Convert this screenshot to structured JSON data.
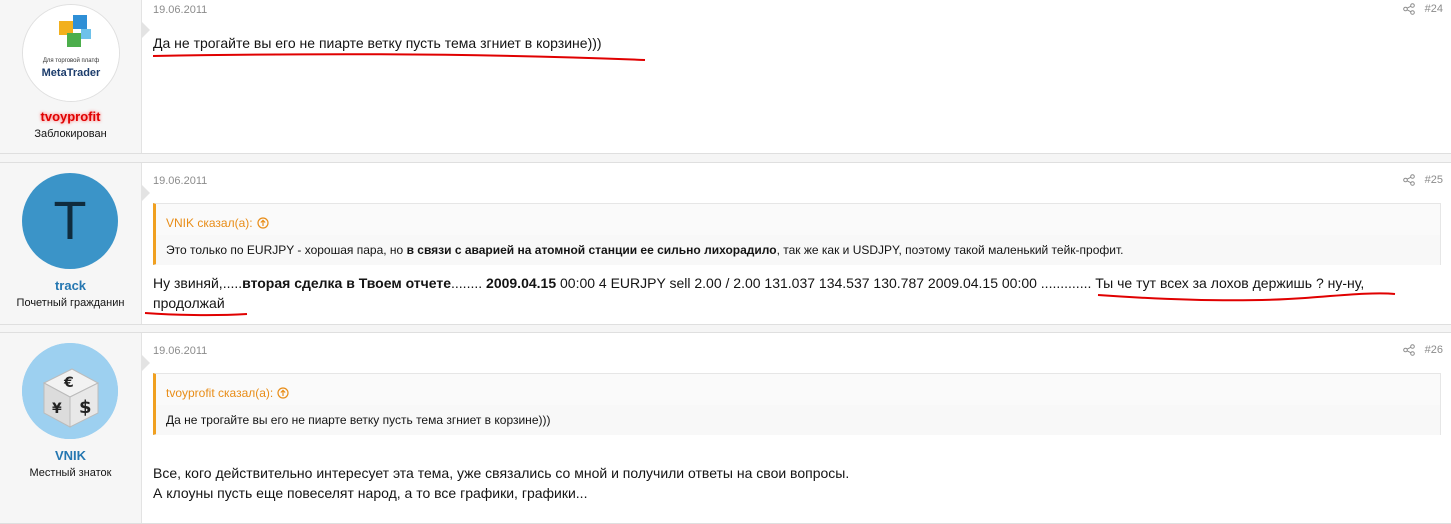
{
  "posts": [
    {
      "date": "19.06.2011",
      "number": "#24",
      "user": {
        "name": "tvoyprofit",
        "title": "Заблокирован",
        "avatar_text_small": "Для торговой платф",
        "avatar_text_main": "MetaTrader"
      },
      "message": "Да не трогайте вы его не пиарте ветку пусть тема згниет в корзине)))"
    },
    {
      "date": "19.06.2011",
      "number": "#25",
      "user": {
        "name": "track",
        "title": "Почетный гражданин",
        "avatar_letter": "T"
      },
      "quote": {
        "author": "VNIK сказал(а):",
        "text_1": "Это только по EURJPY - хорошая пара, но ",
        "text_bold": "в связи с аварией на атомной станции ее сильно лихорадило",
        "text_2": ", так же как и USDJPY, поэтому такой маленький тейк-профит."
      },
      "message": {
        "part1": "Ну звиняй,.....",
        "bold1": "вторая сделка в Твоем отчете",
        "part2": "........ ",
        "bold2": "2009.04.15",
        "part3": " 00:00 4 EURJPY sell 2.00 / 2.00 131.037 134.537 130.787 2009.04.15 00:00 ............. Ты че тут всех за лохов держишь ? ну-ну,",
        "line2": "продолжай"
      }
    },
    {
      "date": "19.06.2011",
      "number": "#26",
      "user": {
        "name": "VNIK",
        "title": "Местный знаток"
      },
      "quote": {
        "author": "tvoyprofit сказал(а):",
        "text": "Да не трогайте вы его не пиарте ветку пусть тема згниет в корзине)))"
      },
      "message_line1": "Все, кого действительно интересует эта тема, уже связались со мной и получили ответы на свои вопросы.",
      "message_line2": "А клоуны пусть еще повеселят народ, а то все графики, графики..."
    }
  ],
  "colors": {
    "username": "#2577b1",
    "quote_accent": "#f0a020",
    "annotation": "#e00000",
    "banned_name": "#e00000"
  }
}
